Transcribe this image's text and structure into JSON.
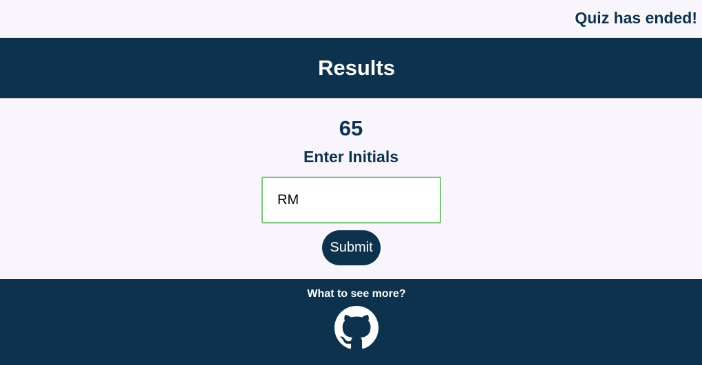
{
  "topbar": {
    "timer_text": "Quiz has ended!"
  },
  "header": {
    "title": "Results"
  },
  "results": {
    "score": "65",
    "prompt": "Enter Initials",
    "initials_value": "RM",
    "submit_label": "Submit"
  },
  "footer": {
    "text": "What to see more?",
    "link_icon": "github-icon"
  },
  "colors": {
    "primary": "#0c324d",
    "background": "#f8f5fd",
    "input_border": "#7cc37c",
    "white": "#ffffff"
  }
}
